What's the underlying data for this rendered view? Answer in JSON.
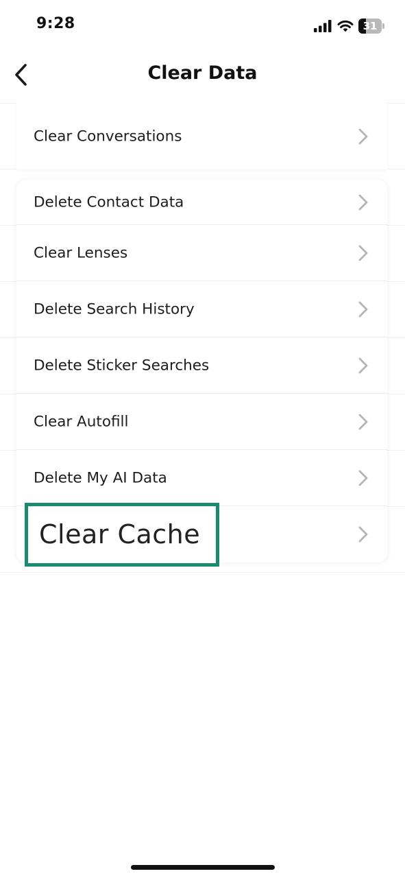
{
  "status_bar": {
    "time": "9:28",
    "battery_level": "31",
    "battery_fraction": 0.31,
    "icons": [
      "cellular-signal-icon",
      "wifi-icon",
      "battery-icon"
    ]
  },
  "header": {
    "title": "Clear Data",
    "back_icon": "chevron-left-icon"
  },
  "sections": [
    {
      "items": [
        {
          "label": "Clear Conversations",
          "icon": "chevron-right-icon"
        }
      ]
    },
    {
      "items": [
        {
          "label": "Delete Contact Data",
          "icon": "chevron-right-icon"
        },
        {
          "label": "Clear Lenses",
          "icon": "chevron-right-icon"
        },
        {
          "label": "Delete Search History",
          "icon": "chevron-right-icon"
        },
        {
          "label": "Delete Sticker Searches",
          "icon": "chevron-right-icon"
        },
        {
          "label": "Clear Autofill",
          "icon": "chevron-right-icon"
        },
        {
          "label": "Delete My AI Data",
          "icon": "chevron-right-icon"
        },
        {
          "label": "Clear Cache",
          "icon": "chevron-right-icon",
          "highlighted": true
        }
      ]
    }
  ],
  "colors": {
    "highlight_border": "#1a8a70",
    "chevron": "#b5b5b5",
    "separator": "#ebebeb"
  }
}
